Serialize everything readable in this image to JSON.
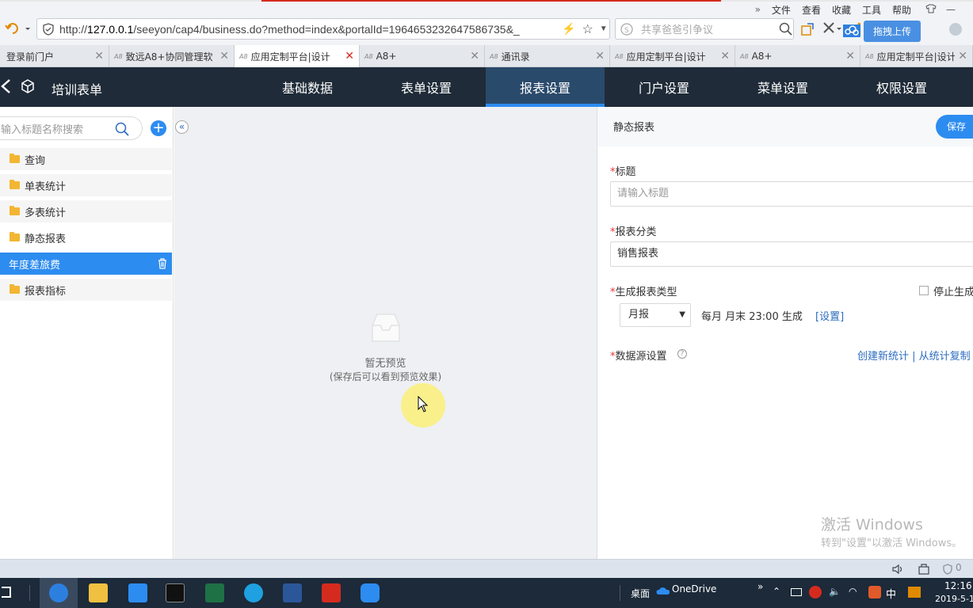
{
  "browser": {
    "menu": [
      "文件",
      "查看",
      "收藏",
      "工具",
      "帮助"
    ],
    "menu_more": "»",
    "url_host": "127.0.0.1",
    "url_prefix": "http://",
    "url_rest": "/seeyon/cap4/business.do?method=index&portalId=1964653232647586735&_",
    "search_placeholder": "共享爸爸引争议",
    "upload_label": "拖拽上传",
    "tabs": [
      {
        "title": "登录前门户",
        "active": false
      },
      {
        "title": "致远A8+协同管理软",
        "active": false
      },
      {
        "title": "应用定制平台|设计",
        "active": true
      },
      {
        "title": "A8+",
        "active": false
      },
      {
        "title": "通讯录",
        "active": false
      },
      {
        "title": "应用定制平台|设计",
        "active": false
      },
      {
        "title": "A8+",
        "active": false
      },
      {
        "title": "应用定制平台|设计",
        "active": false
      }
    ]
  },
  "app": {
    "title": "培训表单",
    "nav": [
      "基础数据",
      "表单设置",
      "报表设置",
      "门户设置",
      "菜单设置",
      "权限设置"
    ],
    "active_nav": "报表设置"
  },
  "sidebar": {
    "search_placeholder": "输入标题名称搜索",
    "items": [
      {
        "label": "查询",
        "type": "folder"
      },
      {
        "label": "单表统计",
        "type": "folder"
      },
      {
        "label": "多表统计",
        "type": "folder"
      },
      {
        "label": "静态报表",
        "type": "folder"
      },
      {
        "label": "年度差旅费",
        "type": "selected"
      },
      {
        "label": "报表指标",
        "type": "folder"
      }
    ]
  },
  "preview": {
    "empty_title": "暂无预览",
    "empty_hint": "(保存后可以看到预览效果)"
  },
  "panel": {
    "header": "静态报表",
    "save_label": "保存",
    "title_label": "标题",
    "title_placeholder": "请输入标题",
    "category_label": "报表分类",
    "category_value": "销售报表",
    "gen_type_label": "生成报表类型",
    "gen_type_value": "月报",
    "gen_desc": "每月 月末 23:00 生成",
    "set_link": "[设置]",
    "stop_label": "停止生成",
    "datasource_label": "数据源设置",
    "datasource_links": "创建新统计 | 从统计复制",
    "required_mark": "*"
  },
  "watermark": {
    "line1": "激活 Windows",
    "line2": "转到\"设置\"以激活 Windows。"
  },
  "taskbar": {
    "desktop_label": "桌面",
    "onedrive_label": "OneDrive",
    "ime": "中",
    "time": "12:16",
    "date": "2019-5-1"
  },
  "statusbar": {
    "count": "0"
  }
}
